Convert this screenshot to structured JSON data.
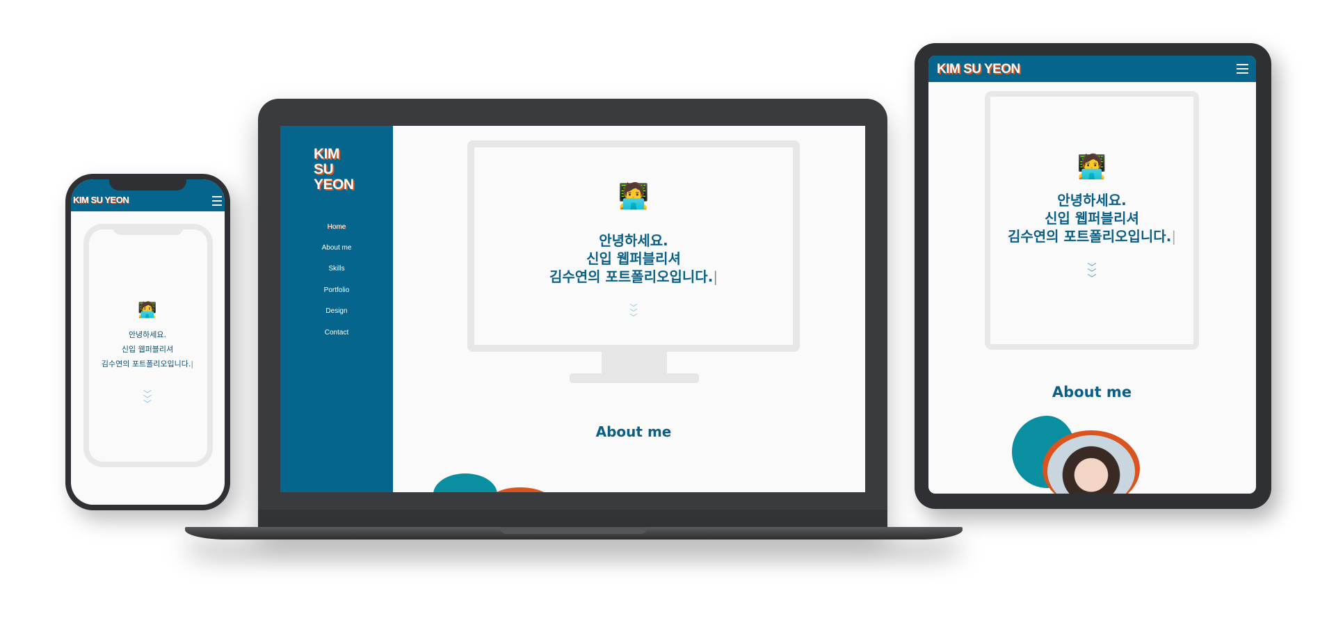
{
  "laptop": {
    "brand": [
      "KIM",
      "SU",
      "YEON"
    ],
    "nav": [
      "Home",
      "About me",
      "Skills",
      "Portfolio",
      "Design",
      "Contact"
    ],
    "active_nav": "Home",
    "greeting": [
      "안녕하세요.",
      "신입 웹퍼블리셔",
      "김수연의 포트폴리오입니다."
    ],
    "about_title": "About me"
  },
  "phone": {
    "brand": "KIM SU YEON",
    "greeting": [
      "안녕하세요.",
      "신입 웹퍼블리셔",
      "김수연의 포트폴리오입니다."
    ]
  },
  "tablet": {
    "brand": "KIM SU YEON",
    "greeting": [
      "안녕하세요.",
      "신입 웹퍼블리셔",
      "김수연의 포트폴리오입니다."
    ],
    "about_title": "About me"
  },
  "icons": {
    "avatar": "person-with-laptop-icon",
    "scroll": "chevrons-down-icon",
    "menu": "hamburger-menu-icon"
  },
  "colors": {
    "brand_teal": "#06658c",
    "accent_orange": "#d9541f",
    "text_teal": "#0a5f86",
    "blob_teal": "#0a8fa1"
  }
}
